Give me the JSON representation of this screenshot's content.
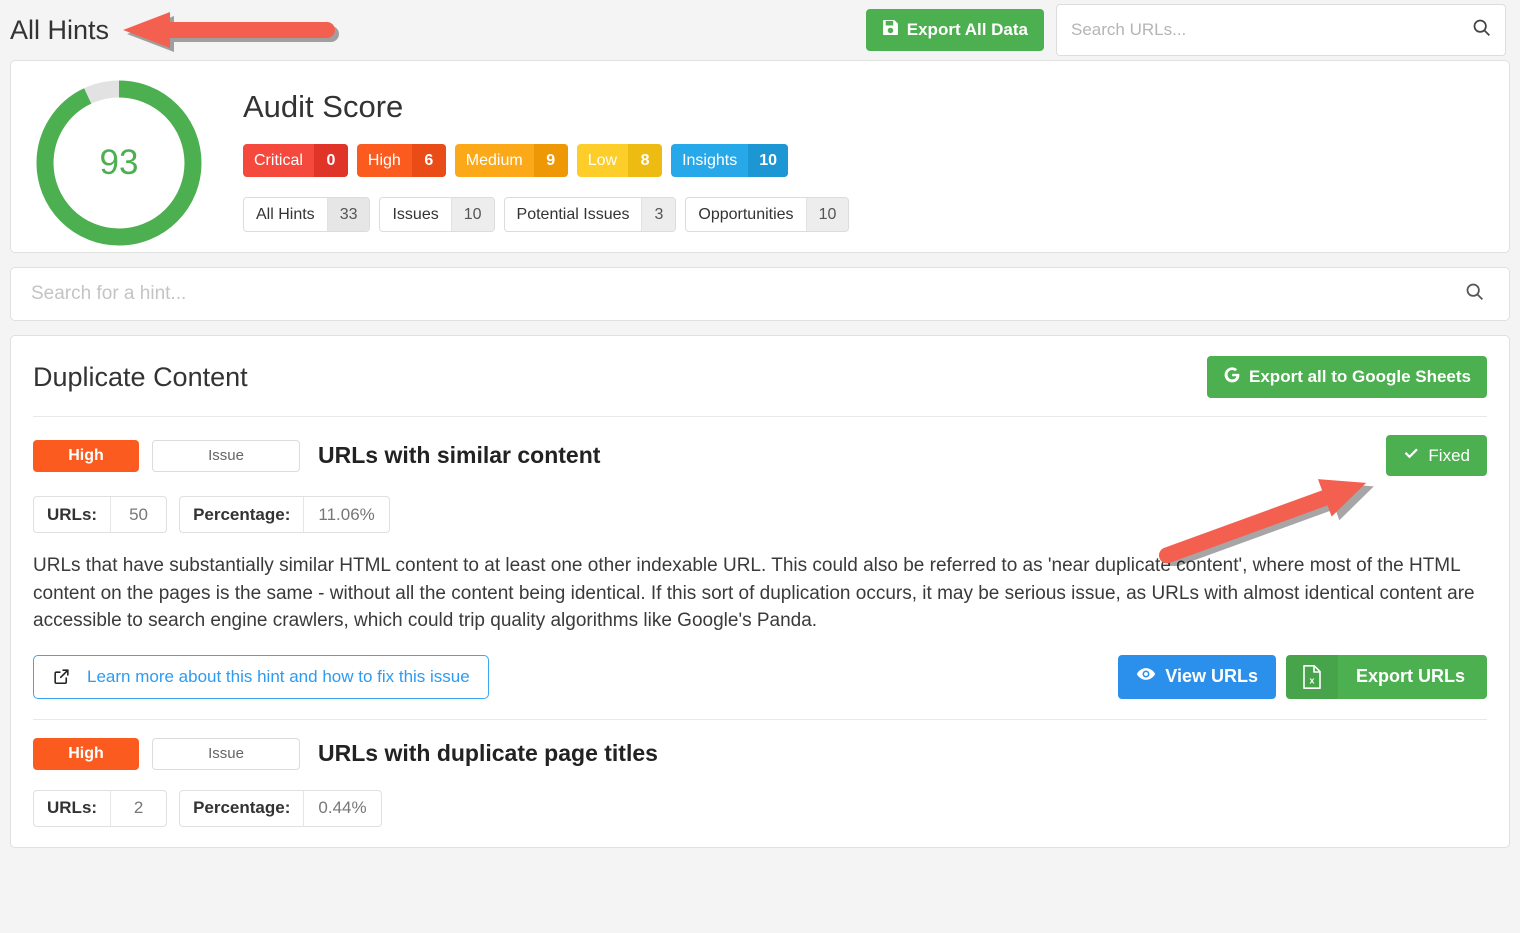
{
  "header": {
    "title": "All Hints",
    "export_all_label": "Export All Data",
    "export_all_icon": "save-icon",
    "search": {
      "placeholder": "Search URLs...",
      "value": "",
      "icon": "search-icon"
    }
  },
  "audit": {
    "title": "Audit Score",
    "score": "93",
    "score_value": 93,
    "ring_color": "#4caf50",
    "ring_track_color": "#e2e2e2",
    "severities": [
      {
        "label": "Critical",
        "count": "0",
        "color": "#f4493c",
        "count_color": "#e03428"
      },
      {
        "label": "High",
        "count": "6",
        "color": "#fb5b1f",
        "count_color": "#ea4c17"
      },
      {
        "label": "Medium",
        "count": "9",
        "color": "#fba919",
        "count_color": "#ef9805"
      },
      {
        "label": "Low",
        "count": "8",
        "color": "#fdcd2a",
        "count_color": "#edbb12"
      },
      {
        "label": "Insights",
        "count": "10",
        "color": "#27a9e9",
        "count_color": "#1d97d3"
      }
    ],
    "filters": [
      {
        "label": "All Hints",
        "count": "33",
        "active": true
      },
      {
        "label": "Issues",
        "count": "10",
        "active": false
      },
      {
        "label": "Potential Issues",
        "count": "3",
        "active": false
      },
      {
        "label": "Opportunities",
        "count": "10",
        "active": false
      }
    ]
  },
  "hint_search": {
    "placeholder": "Search for a hint...",
    "value": "",
    "icon": "search-icon"
  },
  "hints_panel": {
    "title": "Duplicate Content",
    "export_sheets_label": "Export all to Google Sheets",
    "export_sheets_icon": "google-icon",
    "hints": [
      {
        "severity": "High",
        "severity_color": "#fb5b1f",
        "type": "Issue",
        "name": "URLs with similar content",
        "fixed_label": "Fixed",
        "fixed_icon": "check-icon",
        "stats": [
          {
            "key": "URLs:",
            "value": "50"
          },
          {
            "key": "Percentage:",
            "value": "11.06%"
          }
        ],
        "description": "URLs that have substantially similar HTML content to at least one other indexable URL. This could also be referred to as 'near duplicate content', where most of the HTML content on the pages is the same - without all the content being identical. If this sort of duplication occurs, it may be serious issue, as URLs with almost identical content are accessible to search engine crawlers, which could trip quality algorithms like Google's Panda.",
        "learn_more_label": "Learn more about this hint and how to fix this issue",
        "learn_more_icon": "external-link-icon",
        "view_urls_label": "View URLs",
        "view_urls_icon": "eye-icon",
        "export_urls_label": "Export URLs",
        "export_urls_icon": "excel-file-icon"
      },
      {
        "severity": "High",
        "severity_color": "#fb5b1f",
        "type": "Issue",
        "name": "URLs with duplicate page titles",
        "stats": [
          {
            "key": "URLs:",
            "value": "2"
          },
          {
            "key": "Percentage:",
            "value": "0.44%"
          }
        ]
      }
    ]
  },
  "annotations": [
    {
      "name": "arrow-pointing-to-page-title",
      "color": "#f4604f"
    },
    {
      "name": "arrow-pointing-to-fixed-button",
      "color": "#f4604f"
    }
  ]
}
